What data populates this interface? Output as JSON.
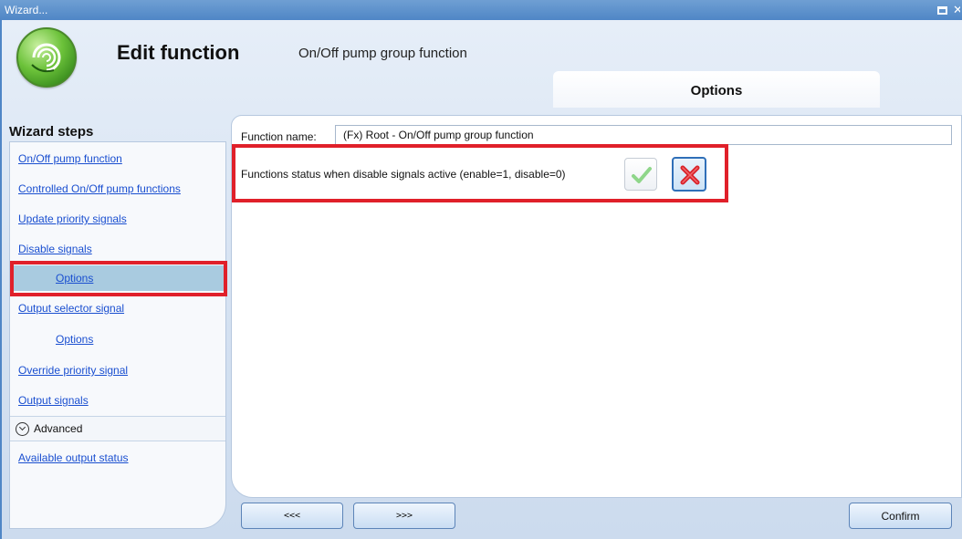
{
  "window": {
    "title": "Wizard...",
    "restore_icon": "restore-icon",
    "close_icon": "close-icon"
  },
  "header": {
    "title": "Edit function",
    "subtitle": "On/Off pump group function",
    "logo_icon": "spiral-logo-icon"
  },
  "tab": {
    "label": "Options"
  },
  "sidebar": {
    "title": "Wizard steps",
    "items": [
      {
        "label": "On/Off pump function"
      },
      {
        "label": "Controlled On/Off pump functions"
      },
      {
        "label": "Update priority signals"
      },
      {
        "label": "Disable signals"
      },
      {
        "label": "Options"
      },
      {
        "label": "Output selector signal"
      },
      {
        "label": "Options"
      },
      {
        "label": "Override priority signal"
      },
      {
        "label": "Output signals"
      }
    ],
    "selected_index": 4,
    "advanced": {
      "label": "Advanced",
      "icon": "chevron-down-circle-icon"
    },
    "advanced_items": [
      {
        "label": "Available output status"
      }
    ]
  },
  "form": {
    "function_name_label": "Function name:",
    "function_name_value": "(Fx) Root - On/Off pump group function",
    "status_label": "Functions status when disable signals active (enable=1, disable=0)",
    "enable_icon": "checkmark-icon",
    "disable_icon": "cross-icon",
    "selected": "disable"
  },
  "footer": {
    "prev_label": "<<<",
    "next_label": ">>>",
    "confirm_label": "Confirm"
  },
  "colors": {
    "highlight": "#e0202a",
    "link": "#1a4fd0",
    "titlebar": "#4f86c6",
    "selected_row": "#a9cbe0"
  }
}
